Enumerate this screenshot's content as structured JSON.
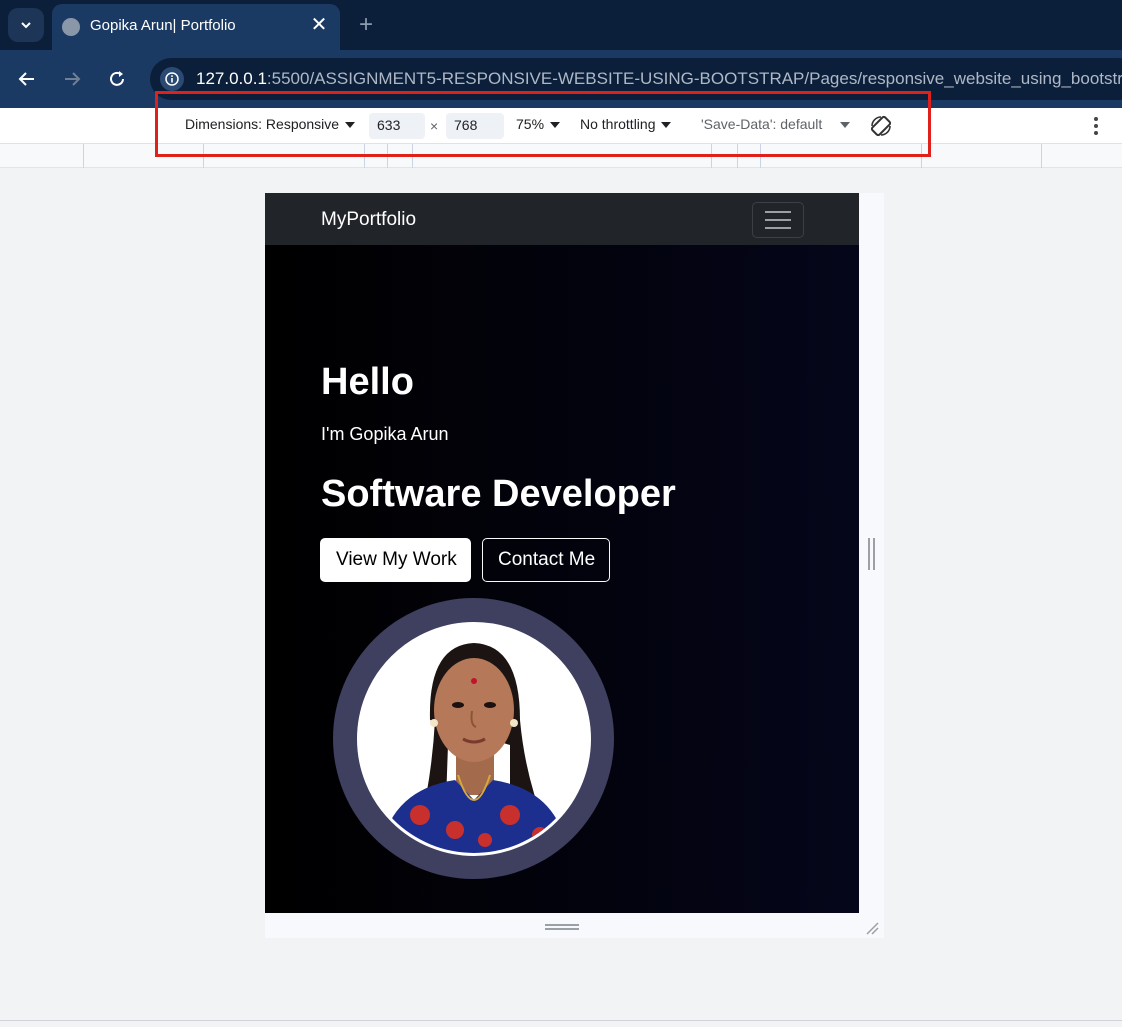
{
  "browser": {
    "tab_title": "Gopika Arun| Portfolio",
    "tab_close": "✕",
    "new_tab": "+",
    "url_host": "127.0.0.1",
    "url_rest": ":5500/ASSIGNMENT5-RESPONSIVE-WEBSITE-USING-BOOTSTRAP/Pages/responsive_website_using_bootstrap.ht"
  },
  "devtools": {
    "dimensions_label": "Dimensions: Responsive",
    "width_value": "633",
    "times": "×",
    "height_value": "768",
    "zoom": "75%",
    "throttling": "No throttling",
    "save_data": "'Save-Data': default"
  },
  "site": {
    "brand": "MyPortfolio",
    "hello": "Hello",
    "intro": "I'm Gopika Arun",
    "role": "Software Developer",
    "btn_work": "View My Work",
    "btn_contact": "Contact Me"
  },
  "colors": {
    "highlight_box": "#e0201a",
    "navbar_bg": "#212529",
    "hero_bg": "#000000",
    "avatar_ring": "#3f3f5f"
  }
}
